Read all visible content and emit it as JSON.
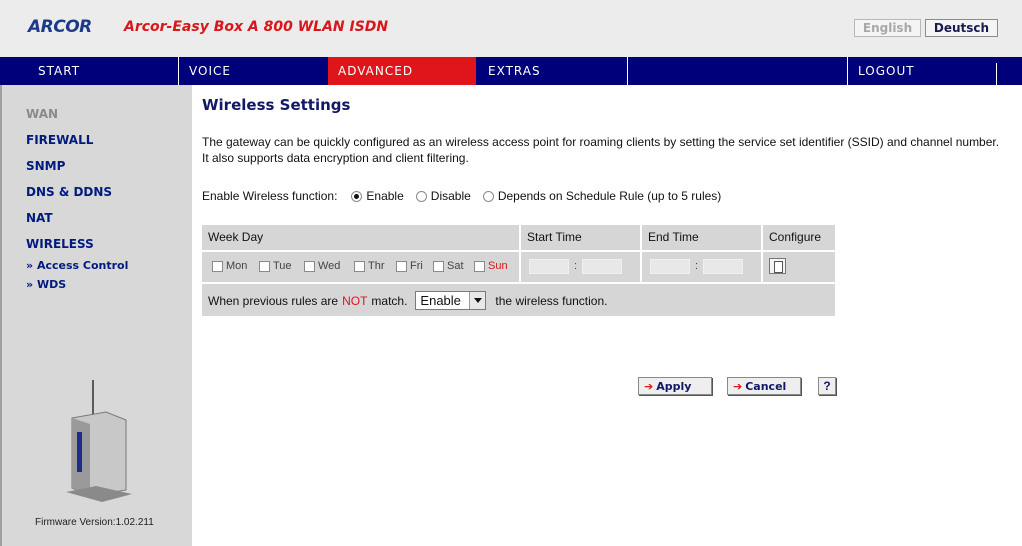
{
  "header": {
    "brand": "ARCOR",
    "product": "Arcor-Easy Box A 800 WLAN ISDN",
    "lang_english": "English",
    "lang_deutsch": "Deutsch"
  },
  "nav": {
    "items": [
      "START",
      "VOICE",
      "ADVANCED",
      "EXTRAS",
      "LOGOUT"
    ],
    "active": "ADVANCED"
  },
  "sidebar": {
    "items": [
      "WAN",
      "FIREWALL",
      "SNMP",
      "DNS & DDNS",
      "NAT",
      "WIRELESS"
    ],
    "subitems": [
      "Access Control",
      "WDS"
    ],
    "firmware": "Firmware Version:1.02.211"
  },
  "main": {
    "title": "Wireless Settings",
    "description": "The gateway can be quickly configured as an wireless access point for roaming clients by setting the service set identifier (SSID) and channel number. It also supports data encryption and client filtering.",
    "enable_label": "Enable Wireless function:",
    "options": [
      "Enable",
      "Disable",
      "Depends on Schedule Rule (up to 5 rules)"
    ],
    "selected_option": "Enable",
    "schedule": {
      "headers": [
        "Week Day",
        "Start Time",
        "End Time",
        "Configure"
      ],
      "days": [
        "Mon",
        "Tue",
        "Wed",
        "Thr",
        "Fri",
        "Sat",
        "Sun"
      ],
      "time_sep": ":",
      "when_prefix": "When previous rules are",
      "when_not": "NOT",
      "when_middle": "match.",
      "select_value": "Enable",
      "when_suffix": "the wireless function."
    },
    "buttons": {
      "apply": "Apply",
      "cancel": "Cancel",
      "help": "?"
    }
  },
  "colors": {
    "nav_bg": "#00007a",
    "active_tab": "#e0141b",
    "sidebar_bg": "#d8d8d8",
    "link": "#001a80"
  }
}
